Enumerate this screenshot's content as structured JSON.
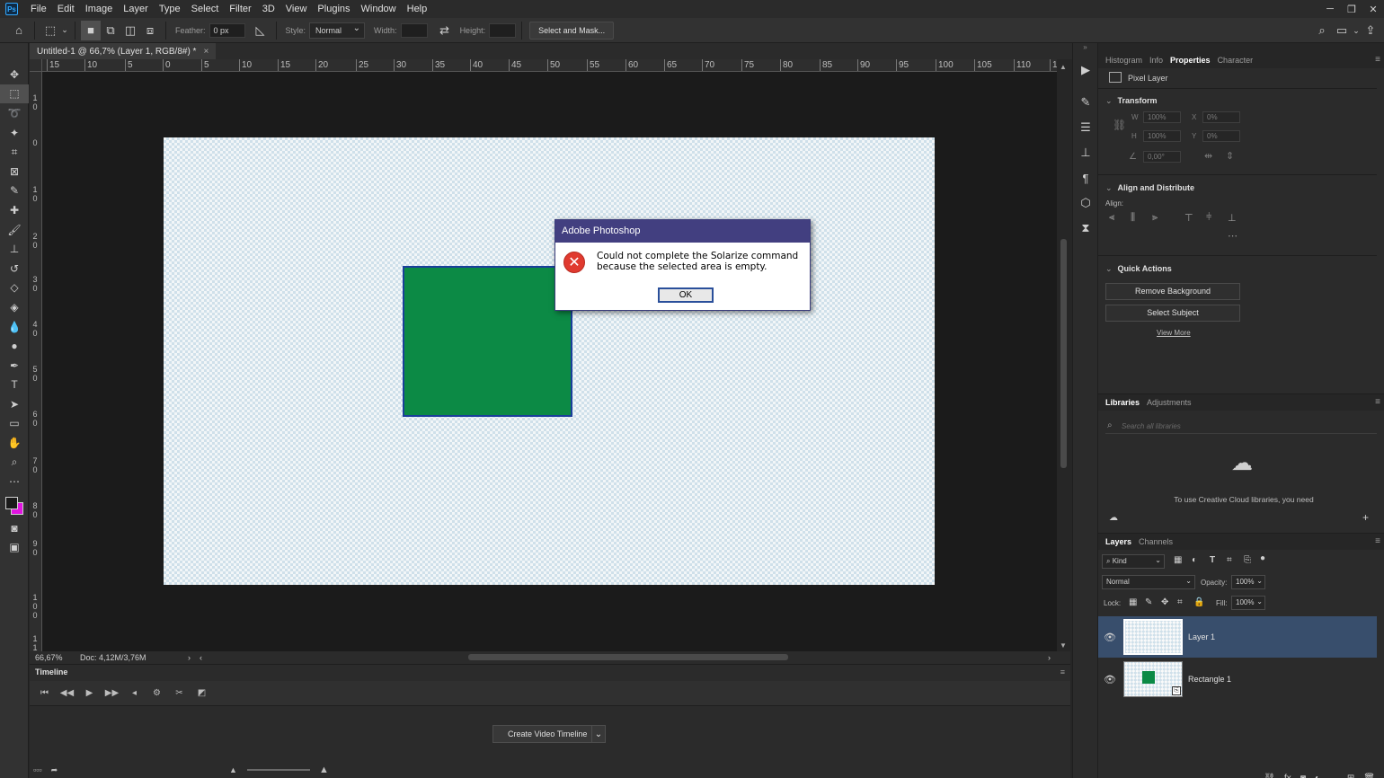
{
  "app": {
    "logo_text": "Ps"
  },
  "menu": [
    "File",
    "Edit",
    "Image",
    "Layer",
    "Type",
    "Select",
    "Filter",
    "3D",
    "View",
    "Plugins",
    "Window",
    "Help"
  ],
  "options_bar": {
    "feather_label": "Feather:",
    "feather_value": "0 px",
    "style_label": "Style:",
    "style_value": "Normal",
    "width_label": "Width:",
    "height_label": "Height:",
    "select_mask_label": "Select and Mask..."
  },
  "document": {
    "tab_title": "Untitled-1 @ 66,7% (Layer 1, RGB/8#) *",
    "close_glyph": "×"
  },
  "ruler_top_labels": [
    "15",
    "10",
    "5",
    "0",
    "5",
    "10",
    "15",
    "20",
    "25",
    "30",
    "35",
    "40",
    "45",
    "50",
    "55",
    "60",
    "65",
    "70",
    "75",
    "80",
    "85",
    "90",
    "95",
    "100",
    "105",
    "110",
    "1"
  ],
  "ruler_left_labels": [
    "1 0",
    "0",
    "1 0",
    "2 0",
    "3 0",
    "4 0",
    "5 0",
    "6 0",
    "7 0",
    "8 0",
    "9 0",
    "1 0 0",
    "1 1"
  ],
  "status": {
    "zoom": "66,67%",
    "doc_size": "Doc: 4,12M/3,76M"
  },
  "timeline": {
    "title": "Timeline",
    "create_button": "Create Video Timeline"
  },
  "dialog": {
    "title": "Adobe Photoshop",
    "message": "Could not complete the Solarize command because the selected area is empty.",
    "ok_label": "OK"
  },
  "properties_panel": {
    "tabs": [
      "Histogram",
      "Info",
      "Properties",
      "Character"
    ],
    "active_tab": "Properties",
    "layer_type": "Pixel Layer",
    "transform_title": "Transform",
    "w_label": "W",
    "w_value": "100%",
    "h_label": "H",
    "h_value": "100%",
    "x_label": "X",
    "x_value": "0%",
    "y_label": "Y",
    "y_value": "0%",
    "angle_value": "0,00°",
    "align_title": "Align and Distribute",
    "align_label": "Align:",
    "quick_actions_title": "Quick Actions",
    "remove_bg": "Remove Background",
    "select_subject": "Select Subject",
    "view_more": "View More"
  },
  "libraries_panel": {
    "tabs": [
      "Libraries",
      "Adjustments"
    ],
    "search_placeholder": "Search all libraries",
    "info_text": "To use Creative Cloud libraries, you need"
  },
  "layers_panel": {
    "tabs": [
      "Layers",
      "Channels"
    ],
    "filter_kind": "Kind",
    "blend_mode": "Normal",
    "opacity_label": "Opacity:",
    "opacity_value": "100%",
    "lock_label": "Lock:",
    "fill_label": "Fill:",
    "fill_value": "100%",
    "layers": [
      {
        "name": "Layer 1",
        "selected": true
      },
      {
        "name": "Rectangle 1",
        "selected": false
      }
    ]
  },
  "colors": {
    "rect_fill": "#0c8a45",
    "rect_stroke": "#1a3f9a",
    "dialog_title_bg": "#423f80",
    "selection_bg": "#384e6c",
    "background_swatch": "#e014e0"
  }
}
